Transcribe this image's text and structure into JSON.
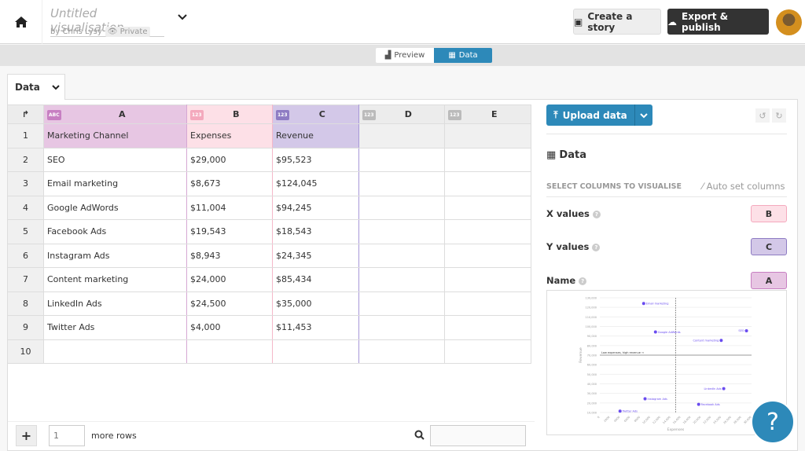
{
  "header": {
    "title": "Untitled visualisation",
    "byline": "by Chris Lysy",
    "privacy": "Private",
    "create_story": "Create a story",
    "export": "Export & publish"
  },
  "view_toggle": {
    "preview": "Preview",
    "data": "Data"
  },
  "sheet_tab": "Data",
  "grid": {
    "columns": [
      {
        "letter": "A",
        "type": "ABC",
        "color": "#c77fc2"
      },
      {
        "letter": "B",
        "type": "123",
        "color": "#f4a9bd"
      },
      {
        "letter": "C",
        "type": "123",
        "color": "#8e7cc3"
      },
      {
        "letter": "D",
        "type": "123",
        "color": "#bbbbbb"
      },
      {
        "letter": "E",
        "type": "123",
        "color": "#bbbbbb"
      }
    ],
    "rows": [
      [
        "Marketing Channel",
        "Expenses",
        "Revenue"
      ],
      [
        "SEO",
        "$29,000",
        "$95,523"
      ],
      [
        "Email marketing",
        "$8,673",
        "$124,045"
      ],
      [
        "Google AdWords",
        "$11,004",
        "$94,245"
      ],
      [
        "Facebook Ads",
        "$19,543",
        "$18,543"
      ],
      [
        "Instagram Ads",
        "$8,943",
        "$24,345"
      ],
      [
        "Content marketing",
        "$24,000",
        "$85,434"
      ],
      [
        "LinkedIn Ads",
        "$24,500",
        "$35,000"
      ],
      [
        "Twitter Ads",
        "$4,000",
        "$11,453"
      ],
      [
        "",
        "",
        ""
      ]
    ]
  },
  "bottom": {
    "add_rows_value": "1",
    "more_rows": "more rows"
  },
  "right": {
    "upload": "Upload data",
    "section": "Data",
    "select_columns": "SELECT COLUMNS TO VISUALISE",
    "auto_set": "Auto set columns",
    "bindings": [
      {
        "label": "X values",
        "col": "B",
        "bg": "#fde0e7",
        "border": "#f4a9bd"
      },
      {
        "label": "Y values",
        "col": "C",
        "bg": "#d3c8e8",
        "border": "#8e7cc3"
      },
      {
        "label": "Name",
        "col": "A",
        "bg": "#e7c6e3",
        "border": "#c77fc2"
      }
    ]
  },
  "help": "?",
  "chart_data": {
    "type": "scatter",
    "xlabel": "Expenses",
    "ylabel": "Revenue",
    "xlim": [
      0,
      30000
    ],
    "ylim": [
      10000,
      130000
    ],
    "grid": true,
    "x_ticks": [
      "0",
      "2000",
      "4000",
      "6000",
      "8000",
      "10,000",
      "12,000",
      "14,000",
      "16,000",
      "18,000",
      "20,000",
      "22,000",
      "24,000",
      "26,000",
      "28,000",
      "30,000"
    ],
    "y_ticks": [
      "10,000",
      "20,000",
      "30,000",
      "40,000",
      "50,000",
      "60,000",
      "70,000",
      "80,000",
      "90,000",
      "100,000",
      "110,000",
      "120,000",
      "130,000"
    ],
    "reference_x": 15000,
    "reference_y": 70000,
    "annotation": "Low expenses, high revenue ⇒",
    "point_color": "#6a4cf0",
    "points": [
      {
        "name": "SEO",
        "x": 29000,
        "y": 95523
      },
      {
        "name": "Email marketing",
        "x": 8673,
        "y": 124045
      },
      {
        "name": "Google AdWords",
        "x": 11004,
        "y": 94245
      },
      {
        "name": "Facebook Ads",
        "x": 19543,
        "y": 18543
      },
      {
        "name": "Instagram Ads",
        "x": 8943,
        "y": 24345
      },
      {
        "name": "Content marketing",
        "x": 24000,
        "y": 85434
      },
      {
        "name": "LinkedIn Ads",
        "x": 24500,
        "y": 35000
      },
      {
        "name": "Twitter Ads",
        "x": 4000,
        "y": 11453
      }
    ]
  }
}
